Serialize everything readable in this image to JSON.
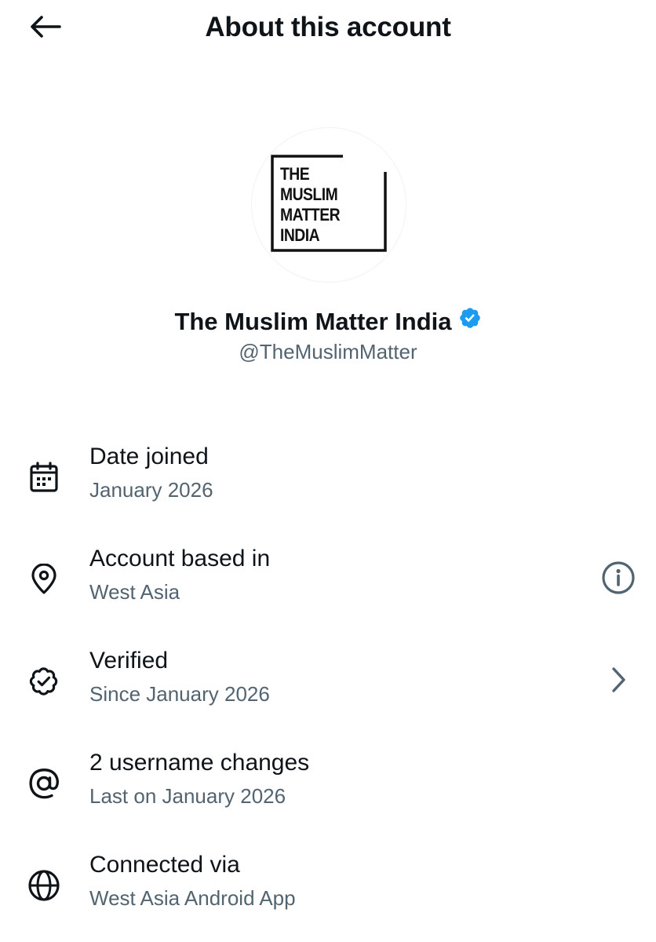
{
  "header": {
    "title": "About this account",
    "back_icon": "arrow-left-icon"
  },
  "profile": {
    "avatar_logo_lines": [
      "THE",
      "MUSLIM",
      "MATTER",
      "INDIA"
    ],
    "display_name": "The Muslim Matter India",
    "handle": "@TheMuslimMatter",
    "verified_badge_color": "#1d9bf0"
  },
  "details": [
    {
      "icon": "calendar-icon",
      "title": "Date joined",
      "subtitle": "January 2026"
    },
    {
      "icon": "location-pin-icon",
      "title": "Account based in",
      "subtitle": "West Asia",
      "action_icon": "info-icon"
    },
    {
      "icon": "verified-badge-icon",
      "title": "Verified",
      "subtitle": "Since January 2026",
      "action_icon": "chevron-right-icon"
    },
    {
      "icon": "at-sign-icon",
      "title": "2 username changes",
      "subtitle": "Last on January 2026"
    },
    {
      "icon": "globe-icon",
      "title": "Connected via",
      "subtitle": "West Asia Android App"
    }
  ],
  "colors": {
    "text_primary": "#0f1419",
    "text_secondary": "#536471",
    "accent": "#1d9bf0"
  }
}
